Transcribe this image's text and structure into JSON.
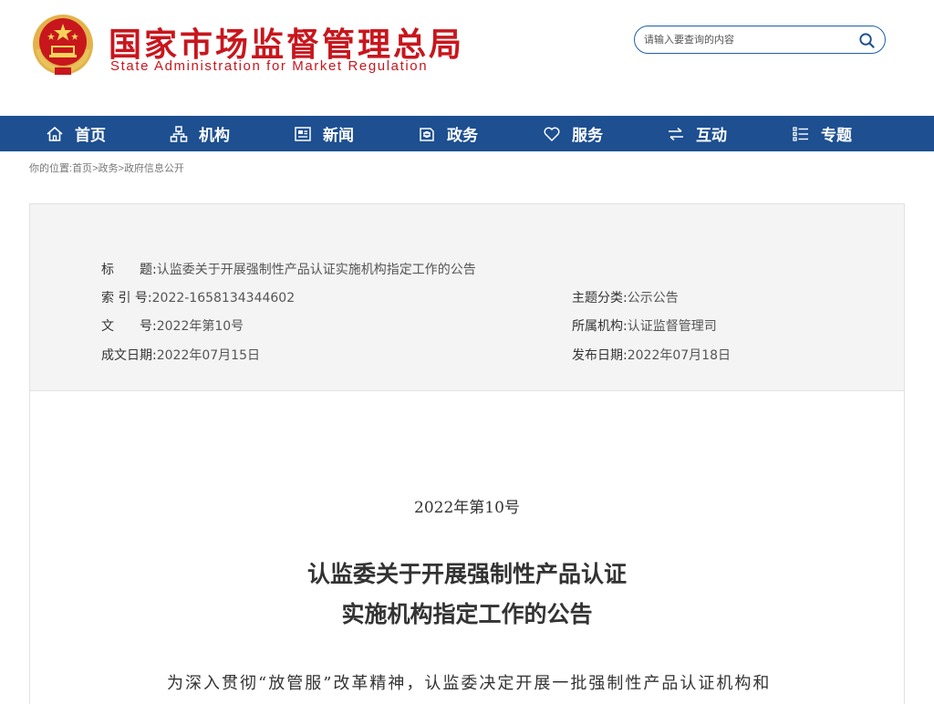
{
  "header": {
    "site_name_cn": "国家市场监督管理总局",
    "site_name_en": "State Administration for Market Regulation",
    "emblem_icon": "national-emblem-icon",
    "search": {
      "placeholder": "请输入要查询的内容",
      "value": ""
    },
    "colors": {
      "brand_red": "#c8161d",
      "nav_blue": "#1d4f91"
    }
  },
  "nav": {
    "items": [
      {
        "label": "首页",
        "icon": "home-icon"
      },
      {
        "label": "机构",
        "icon": "org-chart-icon"
      },
      {
        "label": "新闻",
        "icon": "news-icon"
      },
      {
        "label": "政务",
        "icon": "government-affairs-icon"
      },
      {
        "label": "服务",
        "icon": "heart-icon"
      },
      {
        "label": "互动",
        "icon": "exchange-arrows-icon"
      },
      {
        "label": "专题",
        "icon": "topic-list-icon"
      }
    ]
  },
  "breadcrumb": {
    "prefix": "你的位置:",
    "items": [
      "首页",
      "政务",
      "政府信息公开"
    ],
    "separator": ">"
  },
  "meta": {
    "title_label": "标　　题:",
    "title_value": "认监委关于开展强制性产品认证实施机构指定工作的公告",
    "index_label": "索 引 号:",
    "index_value": "2022-1658134344602",
    "topic_label": "主题分类:",
    "topic_value": "公示公告",
    "docno_label": "文　　号:",
    "docno_value": "2022年第10号",
    "org_label": "所属机构:",
    "org_value": "认证监督管理司",
    "created_label": "成文日期:",
    "created_value": "2022年07月15日",
    "published_label": "发布日期:",
    "published_value": "2022年07月18日"
  },
  "article": {
    "doc_number": "2022年第10号",
    "title_line1": "认监委关于开展强制性产品认证",
    "title_line2": "实施机构指定工作的公告",
    "body_first_line": "为深入贯彻“放管服”改革精神，认监委决定开展一批强制性产品认证机构和"
  }
}
